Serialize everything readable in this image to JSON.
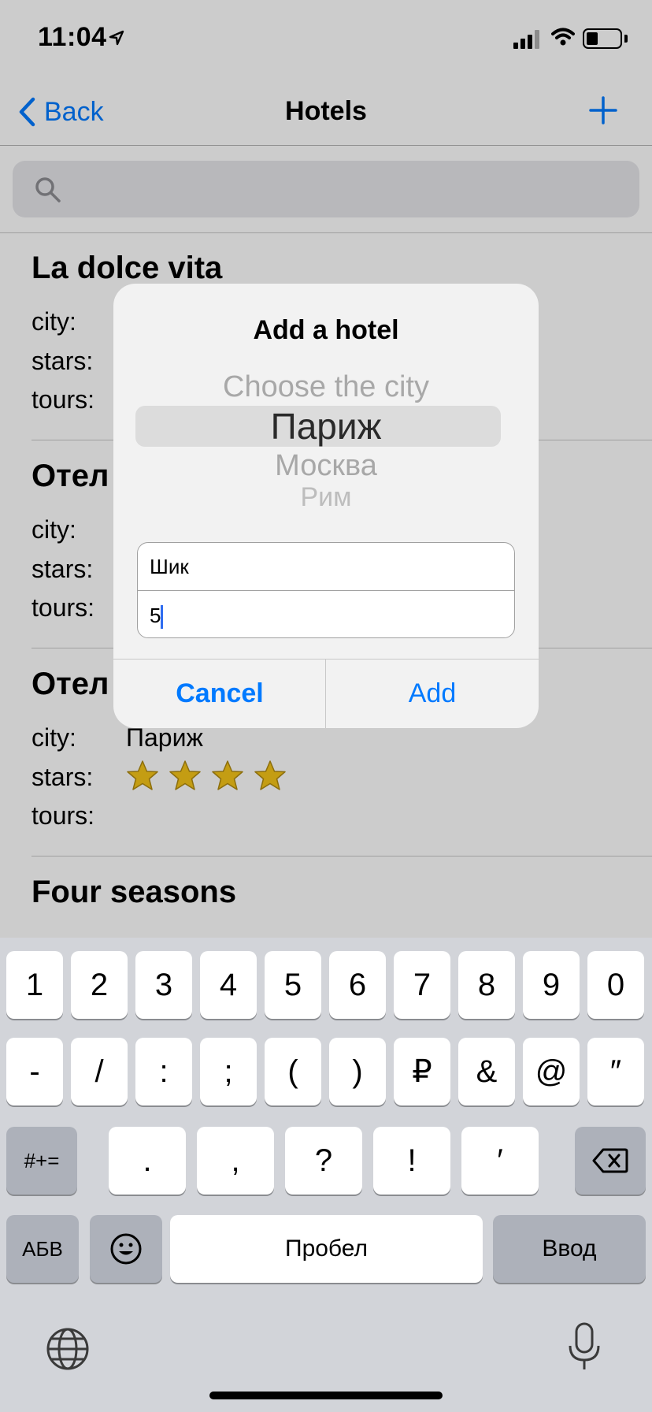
{
  "status": {
    "time": "11:04"
  },
  "nav": {
    "back_label": "Back",
    "title": "Hotels"
  },
  "search": {
    "placeholder": ""
  },
  "hotels": [
    {
      "name": "La dolce vita",
      "labels": {
        "city": "city:",
        "stars": "stars:",
        "tours": "tours:"
      },
      "city": "",
      "star_count": 0
    },
    {
      "name": "Отел",
      "labels": {
        "city": "city:",
        "stars": "stars:",
        "tours": "tours:"
      },
      "city": "",
      "star_count": 0
    },
    {
      "name": "Отел",
      "labels": {
        "city": "city:",
        "stars": "stars:",
        "tours": "tours:"
      },
      "city": "Париж",
      "star_count": 4
    },
    {
      "name": "Four seasons"
    }
  ],
  "alert": {
    "title": "Add a hotel",
    "picker": {
      "options": [
        "Choose the city",
        "Париж",
        "Москва",
        "Рим"
      ],
      "selected": "Париж"
    },
    "name_field": {
      "value": "Шик"
    },
    "stars_field": {
      "value": "5"
    },
    "cancel_label": "Cancel",
    "add_label": "Add"
  },
  "keyboard": {
    "row1": [
      "1",
      "2",
      "3",
      "4",
      "5",
      "6",
      "7",
      "8",
      "9",
      "0"
    ],
    "row2": [
      "-",
      "/",
      ":",
      ";",
      "(",
      ")",
      "₽",
      "&",
      "@",
      "″"
    ],
    "row3": [
      "#+=",
      ".",
      ",",
      "?",
      "!",
      "′"
    ],
    "row4": {
      "lang": "АБВ",
      "space": "Пробел",
      "return": "Ввод"
    }
  },
  "colors": {
    "accent": "#007aff",
    "star": "#f5c518"
  }
}
